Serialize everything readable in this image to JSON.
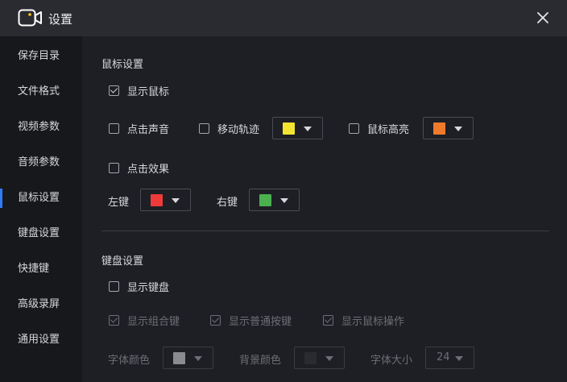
{
  "window": {
    "title": "设置"
  },
  "sidebar": {
    "items": [
      {
        "label": "保存目录"
      },
      {
        "label": "文件格式"
      },
      {
        "label": "视频参数"
      },
      {
        "label": "音频参数"
      },
      {
        "label": "鼠标设置",
        "active": true
      },
      {
        "label": "键盘设置"
      },
      {
        "label": "快捷键"
      },
      {
        "label": "高级录屏"
      },
      {
        "label": "通用设置"
      }
    ]
  },
  "mouse": {
    "title": "鼠标设置",
    "show_cursor": {
      "label": "显示鼠标",
      "checked": true
    },
    "click_sound": {
      "label": "点击声音",
      "checked": false
    },
    "move_trail": {
      "label": "移动轨迹",
      "checked": false,
      "color": "#f3e52f"
    },
    "highlight": {
      "label": "鼠标高亮",
      "checked": false,
      "color": "#f07a2c"
    },
    "click_effect": {
      "label": "点击效果",
      "checked": false
    },
    "left_key": {
      "label": "左键",
      "color": "#f03a3a"
    },
    "right_key": {
      "label": "右键",
      "color": "#4caf50"
    }
  },
  "keyboard": {
    "title": "键盘设置",
    "show_keyboard": {
      "label": "显示键盘",
      "checked": false
    },
    "show_combo": {
      "label": "显示组合键",
      "checked": true,
      "disabled": true
    },
    "show_normal": {
      "label": "显示普通按键",
      "checked": true,
      "disabled": true
    },
    "show_mouse_op": {
      "label": "显示鼠标操作",
      "checked": true,
      "disabled": true
    },
    "font_color": {
      "label": "字体颜色",
      "color": "#8a8b90"
    },
    "bg_color": {
      "label": "背景颜色",
      "color": "#2a2b30"
    },
    "font_size": {
      "label": "字体大小",
      "value": "24"
    }
  },
  "colors": {
    "accent": "#2f7cf6",
    "background": "#1e1f24",
    "sidebar": "#17181c"
  }
}
